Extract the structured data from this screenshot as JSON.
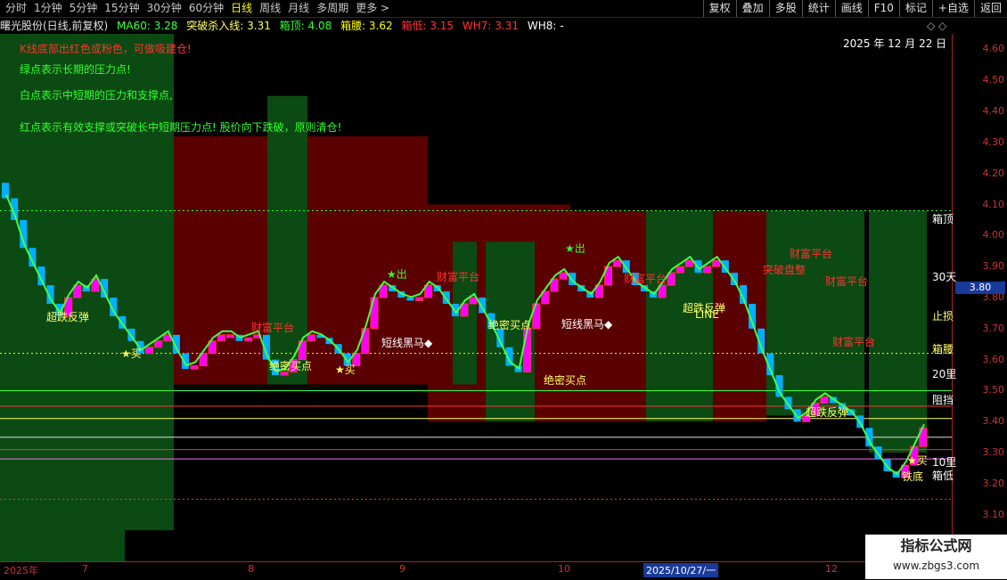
{
  "tabs": [
    "分时",
    "1分钟",
    "5分钟",
    "15分钟",
    "30分钟",
    "60分钟",
    "日线",
    "周线",
    "月线",
    "多周期",
    "更多 >"
  ],
  "active_tab": "日线",
  "tools": [
    "复权",
    "叠加",
    "多股",
    "统计",
    "画线",
    "F10",
    "标记",
    "+自选",
    "返回"
  ],
  "info": {
    "stock": "曙光股份(日线,前复权)",
    "ma60": "MA60: 3.28",
    "kill": "突破杀入线: 3.31",
    "box_top": "箱顶: 4.08",
    "box_waist": "箱腰: 3.62",
    "box_low": "箱低: 3.15",
    "wh7": "WH7: 3.31",
    "wh8": "WH8: -"
  },
  "chart_date": "2025 年 12 月 22 日",
  "notes": [
    "K线底部出红色或粉色，可做吸建仓!",
    "绿点表示长期的压力点!",
    "白点表示中短期的压力和支撑点,",
    "红点表示有效支撑或突破长中短期压力点! 股价向下跌破，原则清仓!"
  ],
  "y_ticks": [
    "4.60",
    "4.50",
    "4.40",
    "4.30",
    "4.20",
    "4.10",
    "4.00",
    "3.90",
    "3.80",
    "3.70",
    "3.60",
    "3.50",
    "3.40",
    "3.30",
    "3.20",
    "3.10",
    "3.00"
  ],
  "current_price": "3.80",
  "x_ticks": [
    "2025年",
    "7",
    "8",
    "9",
    "10",
    "2025/10/27/一",
    "12"
  ],
  "right_labels": [
    "箱顶",
    "30天",
    "止损",
    "箱腰",
    "20里",
    "阻挡",
    "10里",
    "箱低"
  ],
  "chart_labels": {
    "rebound1": "超跌反弹",
    "buy": "★买",
    "secret": "绝密买点",
    "dark_horse": "短线黑马◆",
    "wealth": "财富平台",
    "out": "★出",
    "breakout": "突破盘整",
    "line": "LINE",
    "rebound2": "超跌反弹",
    "bottom": "铁底",
    "zhangting": "涨停"
  },
  "watermark": {
    "title": "指标公式网",
    "url": "www.zbgs3.com"
  },
  "colors": {
    "bull": "#ff00ff",
    "bear": "#00b0ff",
    "greenBar": "#00ff44",
    "redBg": "#5a0000",
    "greenBg": "#0b4a12"
  },
  "chart_data": {
    "type": "candlestick",
    "ylim": [
      2.95,
      4.65
    ],
    "levels": {
      "box_top": 4.08,
      "box_waist": 3.62,
      "box_low": 3.15,
      "ma60": 3.28,
      "kill": 3.31
    },
    "closes": [
      4.12,
      4.05,
      3.96,
      3.9,
      3.84,
      3.78,
      3.74,
      3.8,
      3.84,
      3.82,
      3.86,
      3.8,
      3.74,
      3.7,
      3.66,
      3.62,
      3.64,
      3.66,
      3.68,
      3.62,
      3.57,
      3.58,
      3.62,
      3.66,
      3.68,
      3.68,
      3.66,
      3.67,
      3.68,
      3.6,
      3.55,
      3.56,
      3.6,
      3.66,
      3.68,
      3.67,
      3.65,
      3.62,
      3.58,
      3.62,
      3.7,
      3.8,
      3.84,
      3.82,
      3.8,
      3.79,
      3.8,
      3.84,
      3.82,
      3.78,
      3.74,
      3.78,
      3.8,
      3.75,
      3.7,
      3.64,
      3.58,
      3.56,
      3.7,
      3.78,
      3.82,
      3.86,
      3.88,
      3.84,
      3.82,
      3.8,
      3.84,
      3.9,
      3.92,
      3.88,
      3.84,
      3.82,
      3.8,
      3.84,
      3.88,
      3.9,
      3.92,
      3.88,
      3.9,
      3.92,
      3.88,
      3.84,
      3.78,
      3.7,
      3.62,
      3.55,
      3.48,
      3.44,
      3.4,
      3.42,
      3.46,
      3.48,
      3.46,
      3.44,
      3.42,
      3.38,
      3.32,
      3.28,
      3.24,
      3.22,
      3.26,
      3.32,
      3.38
    ]
  }
}
